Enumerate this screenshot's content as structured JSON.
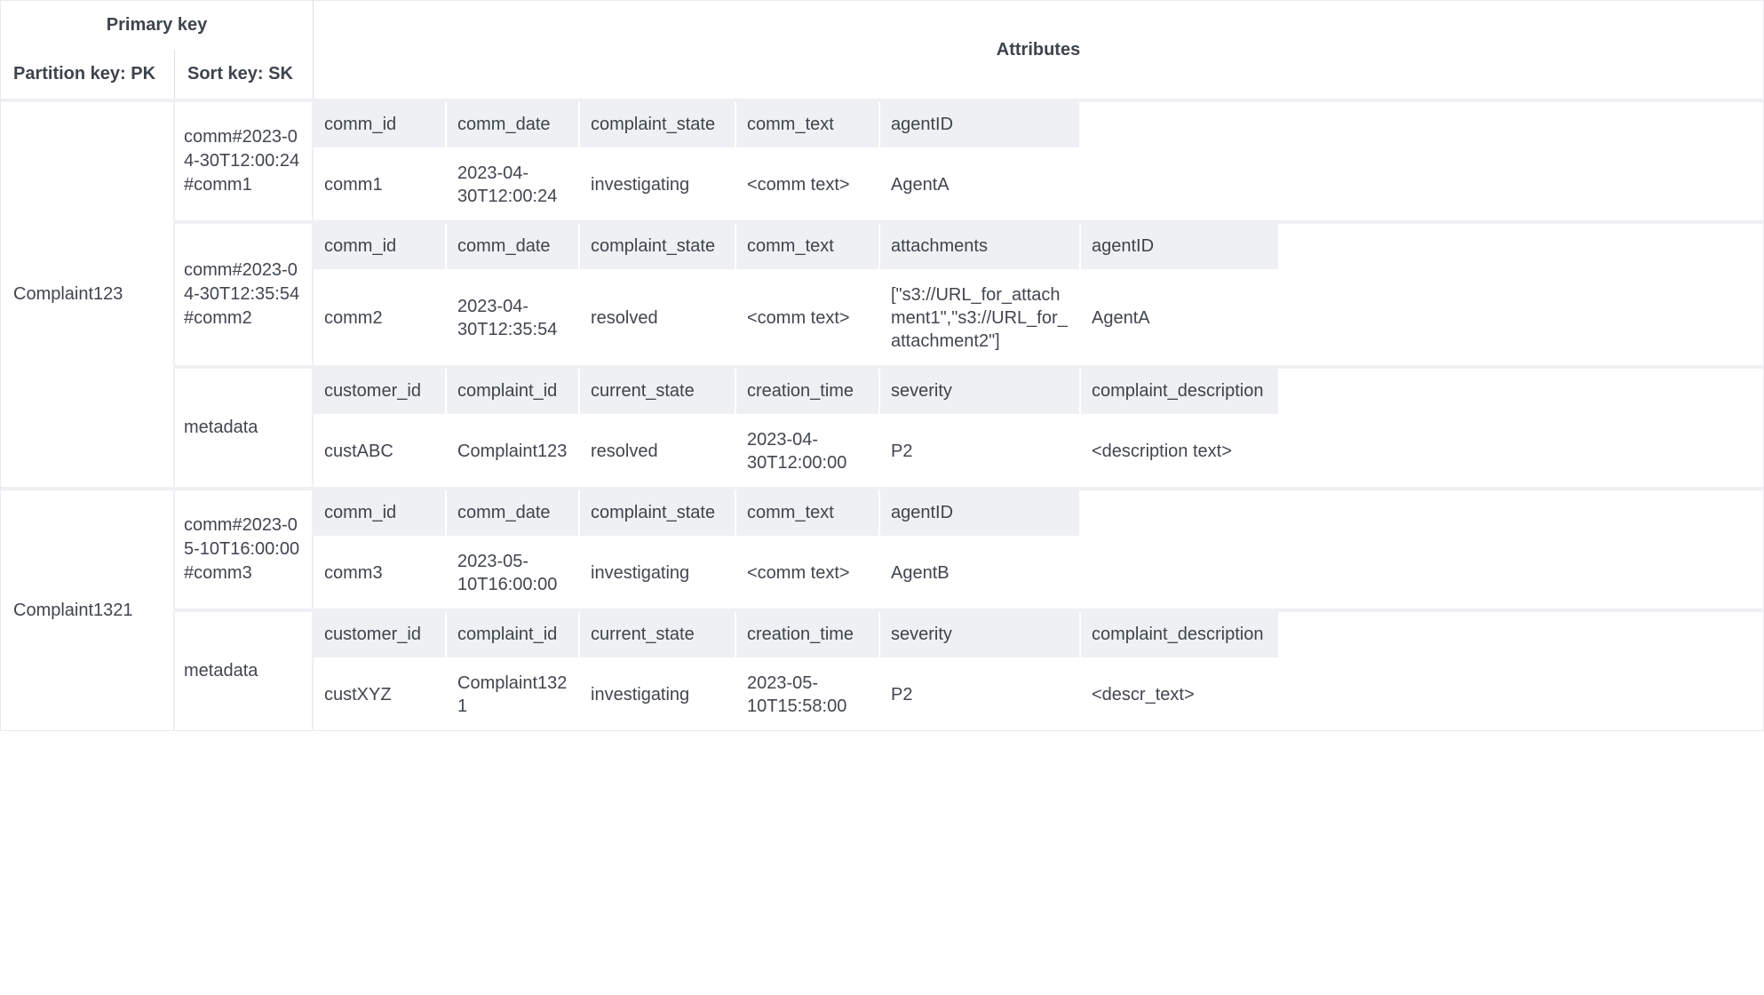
{
  "headers": {
    "primary_key": "Primary key",
    "attributes": "Attributes",
    "partition_key": "Partition key: PK",
    "sort_key": "Sort key: SK"
  },
  "partitions": [
    {
      "pk": "Complaint123",
      "items": [
        {
          "sk": "comm#2023-04-30T12:00:24#comm1",
          "cols": 6,
          "attrs": [
            {
              "h": "comm_id",
              "v": "comm1"
            },
            {
              "h": "comm_date",
              "v": "2023-04-30T12:00:24"
            },
            {
              "h": "complaint_state",
              "v": "investigating"
            },
            {
              "h": "comm_text",
              "v": "<comm text>"
            },
            {
              "h": "agentID",
              "v": "AgentA"
            },
            {
              "h": "",
              "v": ""
            }
          ]
        },
        {
          "sk": "comm#2023-04-30T12:35:54#comm2",
          "cols": 6,
          "attrs": [
            {
              "h": "comm_id",
              "v": "comm2"
            },
            {
              "h": "comm_date",
              "v": "2023-04-30T12:35:54"
            },
            {
              "h": "complaint_state",
              "v": "resolved"
            },
            {
              "h": "comm_text",
              "v": "<comm text>"
            },
            {
              "h": "attachments",
              "v": "[\"s3://URL_for_attachment1\",\"s3://URL_for_attachment2\"]"
            },
            {
              "h": "agentID",
              "v": "AgentA"
            }
          ]
        },
        {
          "sk": "metadata",
          "cols": 6,
          "attrs": [
            {
              "h": "customer_id",
              "v": "custABC"
            },
            {
              "h": "complaint_id",
              "v": "Complaint123"
            },
            {
              "h": "current_state",
              "v": "resolved"
            },
            {
              "h": "creation_time",
              "v": "2023-04-30T12:00:00"
            },
            {
              "h": "severity",
              "v": "P2"
            },
            {
              "h": "complaint_description",
              "v": "<description text>"
            }
          ]
        }
      ]
    },
    {
      "pk": "Complaint1321",
      "items": [
        {
          "sk": "comm#2023-05-10T16:00:00#comm3",
          "cols": 6,
          "attrs": [
            {
              "h": "comm_id",
              "v": "comm3"
            },
            {
              "h": "comm_date",
              "v": "2023-05-10T16:00:00"
            },
            {
              "h": "complaint_state",
              "v": "investigating"
            },
            {
              "h": "comm_text",
              "v": "<comm text>"
            },
            {
              "h": "agentID",
              "v": "AgentB"
            },
            {
              "h": "",
              "v": ""
            }
          ]
        },
        {
          "sk": "metadata",
          "cols": 6,
          "attrs": [
            {
              "h": "customer_id",
              "v": "custXYZ"
            },
            {
              "h": "complaint_id",
              "v": "Complaint1321"
            },
            {
              "h": "current_state",
              "v": "investigating"
            },
            {
              "h": "creation_time",
              "v": "2023-05-10T15:58:00"
            },
            {
              "h": "severity",
              "v": "P2"
            },
            {
              "h": "complaint_description",
              "v": "<descr_text>"
            }
          ]
        }
      ]
    }
  ]
}
